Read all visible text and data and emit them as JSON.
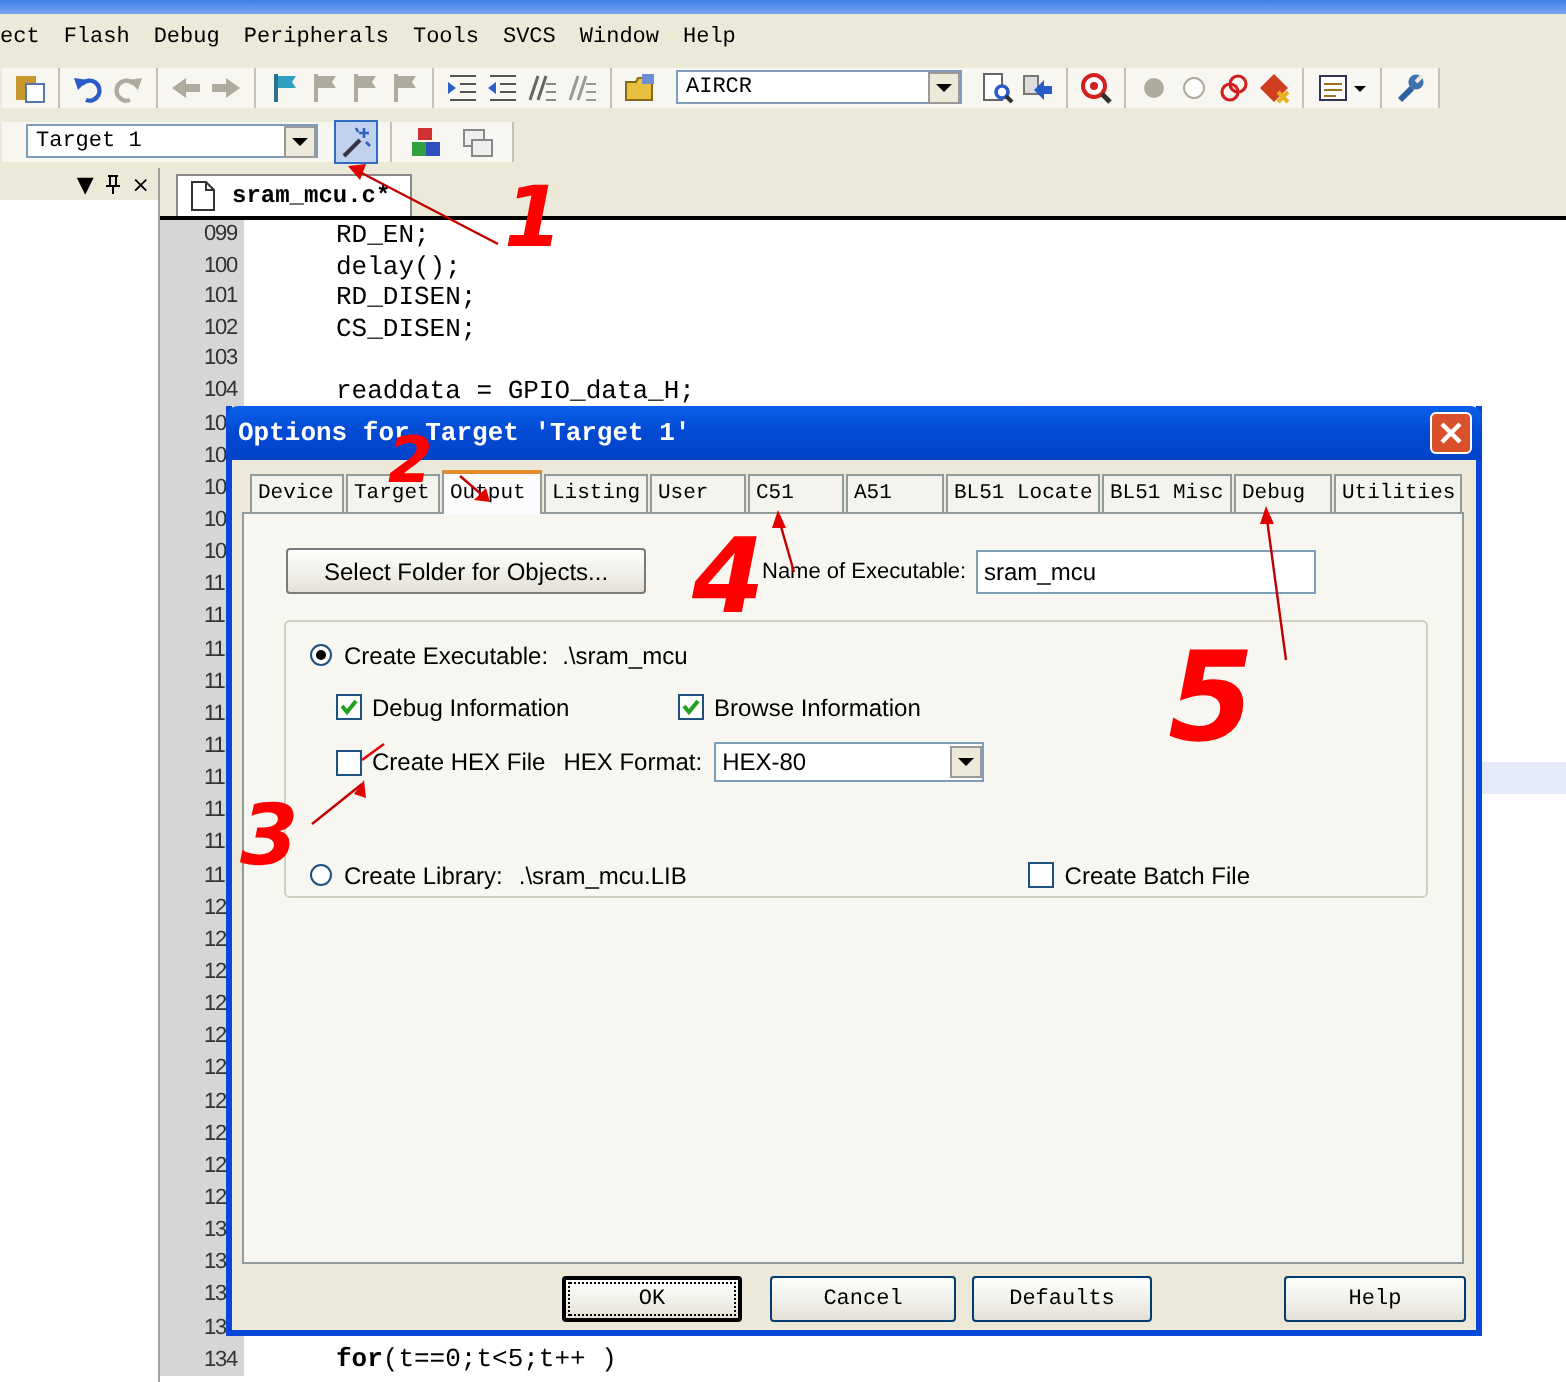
{
  "menu": [
    {
      "label": "ect"
    },
    {
      "label": "Flash"
    },
    {
      "label": "Debug"
    },
    {
      "label": "Peripherals"
    },
    {
      "label": "Tools"
    },
    {
      "label": "SVCS"
    },
    {
      "label": "Window"
    },
    {
      "label": "Help"
    }
  ],
  "toolbar": {
    "groups": [
      {
        "items": [
          {
            "kind": "paste",
            "disabled": false
          }
        ]
      },
      {
        "items": [
          {
            "kind": "undo",
            "disabled": false
          },
          {
            "kind": "redo",
            "disabled": true
          }
        ]
      },
      {
        "items": [
          {
            "kind": "back",
            "disabled": true
          },
          {
            "kind": "forward",
            "disabled": true
          }
        ]
      },
      {
        "items": [
          {
            "kind": "bookmark",
            "disabled": false
          },
          {
            "kind": "bookmark",
            "disabled": true
          },
          {
            "kind": "bookmark",
            "disabled": true
          },
          {
            "kind": "bookmark",
            "disabled": true
          }
        ]
      },
      {
        "items": [
          {
            "kind": "indent",
            "disabled": false
          },
          {
            "kind": "outdent",
            "disabled": false
          },
          {
            "kind": "comment",
            "disabled": false
          },
          {
            "kind": "uncomment",
            "disabled": false
          }
        ]
      },
      {
        "items": [
          {
            "kind": "find-files",
            "disabled": false
          },
          {
            "kind": "combo",
            "value": "AIRCR"
          },
          {
            "kind": "find",
            "disabled": false
          },
          {
            "kind": "replace",
            "disabled": false
          }
        ]
      },
      {
        "items": [
          {
            "kind": "debug",
            "disabled": false
          }
        ]
      },
      {
        "items": [
          {
            "kind": "breakpoint",
            "disabled": true
          },
          {
            "kind": "breakpoint-hollow",
            "disabled": true
          },
          {
            "kind": "rings",
            "disabled": false
          },
          {
            "kind": "kill",
            "disabled": false
          }
        ]
      },
      {
        "items": [
          {
            "kind": "window",
            "disabled": false
          }
        ]
      },
      {
        "items": [
          {
            "kind": "settings",
            "disabled": false
          }
        ]
      }
    ]
  },
  "build_toolbar": {
    "target": {
      "value": "Target 1"
    },
    "items": [
      {
        "kind": "options",
        "pressed": true
      },
      {
        "kind": "components",
        "pressed": false
      },
      {
        "kind": "books",
        "pressed": false
      }
    ]
  },
  "project_panel": {
    "controls": [
      "▼",
      "×"
    ]
  },
  "editor": {
    "tab": {
      "label": "sram_mcu.c*"
    },
    "lines": [
      {
        "number": "099",
        "code": "RD_EN;",
        "current": false
      },
      {
        "number": "100",
        "code": "delay();",
        "current": false
      },
      {
        "number": "101",
        "code": "RD_DISEN;",
        "current": false
      },
      {
        "number": "102",
        "code": "CS_DISEN;",
        "current": false
      },
      {
        "number": "103",
        "current": false
      },
      {
        "number": "104",
        "code": "readdata = GPIO_data_H;",
        "current": false
      },
      {
        "number": "10",
        "current": false
      },
      {
        "number": "10",
        "current": false
      },
      {
        "number": "10",
        "current": false
      },
      {
        "number": "10",
        "current": false
      },
      {
        "number": "10",
        "current": false
      },
      {
        "number": "11",
        "current": false
      },
      {
        "number": "11",
        "current": false
      },
      {
        "number": "11",
        "current": false
      },
      {
        "number": "11",
        "current": false
      },
      {
        "number": "11",
        "current": false
      },
      {
        "number": "11",
        "current": false
      },
      {
        "number": "11",
        "current": true
      },
      {
        "number": "11",
        "current": false
      },
      {
        "number": "11",
        "current": false
      },
      {
        "number": "11",
        "current": false
      },
      {
        "number": "12",
        "current": false
      },
      {
        "number": "12",
        "current": false
      },
      {
        "number": "12",
        "current": false
      },
      {
        "number": "12",
        "current": false
      },
      {
        "number": "12",
        "current": false
      },
      {
        "number": "12",
        "current": false
      },
      {
        "number": "12",
        "current": false
      },
      {
        "number": "12",
        "current": false
      },
      {
        "number": "12",
        "current": false
      },
      {
        "number": "12",
        "current": false
      },
      {
        "number": "13",
        "current": false
      },
      {
        "number": "13",
        "current": false
      },
      {
        "number": "13",
        "current": false
      },
      {
        "number": "13",
        "current": false
      },
      {
        "number": "134",
        "code": "**for**(t==0;t<5;t++ )",
        "current": false
      }
    ]
  },
  "dialog": {
    "title": "Options for Target 'Target 1'",
    "tabs": [
      {
        "label": "Device",
        "selected": false
      },
      {
        "label": "Target",
        "selected": false
      },
      {
        "label": "Output",
        "selected": true
      },
      {
        "label": "Listing",
        "selected": false
      },
      {
        "label": "User",
        "selected": false
      },
      {
        "label": "C51",
        "selected": false
      },
      {
        "label": "A51",
        "selected": false
      },
      {
        "label": "BL51 Locate",
        "selected": false
      },
      {
        "label": "BL51 Misc",
        "selected": false
      },
      {
        "label": "Debug",
        "selected": false
      },
      {
        "label": "Utilities",
        "selected": false
      }
    ],
    "select_folder_button": "Select Folder for Objects...",
    "executable_name": {
      "label": "Name of Executable:",
      "value": "sram_mcu"
    },
    "output_kind": [
      {
        "label": "Create Executable:",
        "path": ".\\sram_mcu",
        "selected": true
      },
      {
        "label": "Create Library:",
        "path": ".\\sram_mcu.LIB",
        "selected": false
      }
    ],
    "debug_information": {
      "label": "Debug Information",
      "checked": true
    },
    "browse_information": {
      "label": "Browse Information",
      "checked": true
    },
    "create_hex_file": {
      "label": "Create HEX File",
      "checked": false
    },
    "hex_format": {
      "label": "HEX Format:",
      "value": "HEX-80"
    },
    "create_batch_file": {
      "label": "Create Batch File",
      "checked": false
    },
    "buttons": [
      {
        "label": "OK",
        "focused": true
      },
      {
        "label": "Cancel",
        "focused": false
      },
      {
        "label": "Defaults",
        "focused": false
      },
      {
        "label": "Help",
        "focused": false
      }
    ]
  },
  "annotations": [
    {
      "label": "1"
    },
    {
      "label": "2"
    },
    {
      "label": "3"
    },
    {
      "label": "4"
    },
    {
      "label": "5"
    }
  ]
}
